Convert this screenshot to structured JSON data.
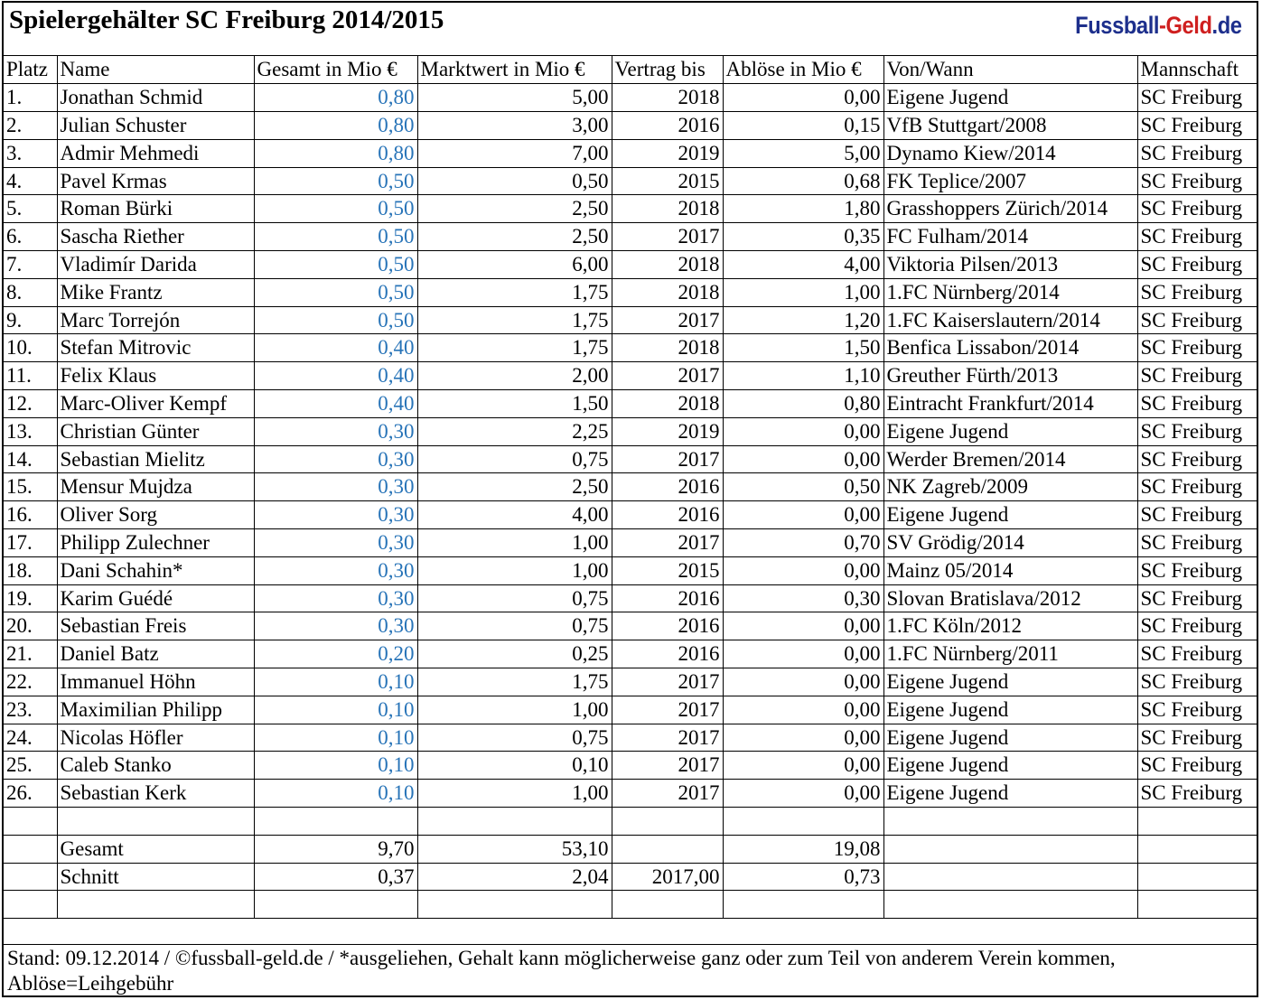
{
  "title": "Spielergehälter SC Freiburg 2014/2015",
  "brand": {
    "part1": "Fussball",
    "part2": "-Geld",
    "part3": ".de"
  },
  "columns": [
    "Platz",
    "Name",
    "Gesamt in Mio €",
    "Marktwert in Mio €",
    "Vertrag bis",
    "Ablöse in Mio €",
    "Von/Wann",
    "Mannschaft"
  ],
  "rows": [
    [
      "1.",
      "Jonathan Schmid",
      "0,80",
      "5,00",
      "2018",
      "0,00",
      "Eigene Jugend",
      "SC Freiburg"
    ],
    [
      "2.",
      "Julian Schuster",
      "0,80",
      "3,00",
      "2016",
      "0,15",
      "VfB Stuttgart/2008",
      "SC Freiburg"
    ],
    [
      "3.",
      "Admir Mehmedi",
      "0,80",
      "7,00",
      "2019",
      "5,00",
      "Dynamo Kiew/2014",
      "SC Freiburg"
    ],
    [
      "4.",
      "Pavel Krmas",
      "0,50",
      "0,50",
      "2015",
      "0,68",
      "FK Teplice/2007",
      "SC Freiburg"
    ],
    [
      "5.",
      "Roman Bürki",
      "0,50",
      "2,50",
      "2018",
      "1,80",
      "Grasshoppers Zürich/2014",
      "SC Freiburg"
    ],
    [
      "6.",
      "Sascha Riether",
      "0,50",
      "2,50",
      "2017",
      "0,35",
      "FC Fulham/2014",
      "SC Freiburg"
    ],
    [
      "7.",
      "Vladimír Darida",
      "0,50",
      "6,00",
      "2018",
      "4,00",
      "Viktoria Pilsen/2013",
      "SC Freiburg"
    ],
    [
      "8.",
      "Mike Frantz",
      "0,50",
      "1,75",
      "2018",
      "1,00",
      "1.FC Nürnberg/2014",
      "SC Freiburg"
    ],
    [
      "9.",
      "Marc Torrejón",
      "0,50",
      "1,75",
      "2017",
      "1,20",
      "1.FC Kaiserslautern/2014",
      "SC Freiburg"
    ],
    [
      "10.",
      "Stefan Mitrovic",
      "0,40",
      "1,75",
      "2018",
      "1,50",
      "Benfica Lissabon/2014",
      "SC Freiburg"
    ],
    [
      "11.",
      "Felix Klaus",
      "0,40",
      "2,00",
      "2017",
      "1,10",
      "Greuther Fürth/2013",
      "SC Freiburg"
    ],
    [
      "12.",
      "Marc-Oliver Kempf",
      "0,40",
      "1,50",
      "2018",
      "0,80",
      "Eintracht Frankfurt/2014",
      "SC Freiburg"
    ],
    [
      "13.",
      "Christian Günter",
      "0,30",
      "2,25",
      "2019",
      "0,00",
      "Eigene Jugend",
      "SC Freiburg"
    ],
    [
      "14.",
      "Sebastian Mielitz",
      "0,30",
      "0,75",
      "2017",
      "0,00",
      "Werder Bremen/2014",
      "SC Freiburg"
    ],
    [
      "15.",
      "Mensur Mujdza",
      "0,30",
      "2,50",
      "2016",
      "0,50",
      "NK Zagreb/2009",
      "SC Freiburg"
    ],
    [
      "16.",
      "Oliver Sorg",
      "0,30",
      "4,00",
      "2016",
      "0,00",
      "Eigene Jugend",
      "SC Freiburg"
    ],
    [
      "17.",
      "Philipp Zulechner",
      "0,30",
      "1,00",
      "2017",
      "0,70",
      "SV Grödig/2014",
      "SC Freiburg"
    ],
    [
      "18.",
      "Dani Schahin*",
      "0,30",
      "1,00",
      "2015",
      "0,00",
      "Mainz 05/2014",
      "SC Freiburg"
    ],
    [
      "19.",
      "Karim Guédé",
      "0,30",
      "0,75",
      "2016",
      "0,30",
      "Slovan Bratislava/2012",
      "SC Freiburg"
    ],
    [
      "20.",
      "Sebastian Freis",
      "0,30",
      "0,75",
      "2016",
      "0,00",
      "1.FC Köln/2012",
      "SC Freiburg"
    ],
    [
      "21.",
      "Daniel Batz",
      "0,20",
      "0,25",
      "2016",
      "0,00",
      "1.FC Nürnberg/2011",
      "SC Freiburg"
    ],
    [
      "22.",
      "Immanuel Höhn",
      "0,10",
      "1,75",
      "2017",
      "0,00",
      "Eigene Jugend",
      "SC Freiburg"
    ],
    [
      "23.",
      "Maximilian Philipp",
      "0,10",
      "1,00",
      "2017",
      "0,00",
      "Eigene Jugend",
      "SC Freiburg"
    ],
    [
      "24.",
      "Nicolas Höfler",
      "0,10",
      "0,75",
      "2017",
      "0,00",
      "Eigene Jugend",
      "SC Freiburg"
    ],
    [
      "25.",
      "Caleb Stanko",
      "0,10",
      "0,10",
      "2017",
      "0,00",
      "Eigene Jugend",
      "SC Freiburg"
    ],
    [
      "26.",
      "Sebastian Kerk",
      "0,10",
      "1,00",
      "2017",
      "0,00",
      "Eigene Jugend",
      "SC Freiburg"
    ]
  ],
  "totals": {
    "label": "Gesamt",
    "gesamt": "9,70",
    "marktwert": "53,10",
    "vertrag": "",
    "abloese": "19,08"
  },
  "average": {
    "label": "Schnitt",
    "gesamt": "0,37",
    "marktwert": "2,04",
    "vertrag": "2017,00",
    "abloese": "0,73"
  },
  "footer": "Stand: 09.12.2014 / ©fussball-geld.de / *ausgeliehen, Gehalt kann möglicherweise ganz oder zum Teil von anderem Verein kommen, Ablöse=Leihgebühr",
  "colors": {
    "salary_text": "#2874b8",
    "brand_blue": "#1d2f8c",
    "brand_red": "#cf1f1f"
  }
}
